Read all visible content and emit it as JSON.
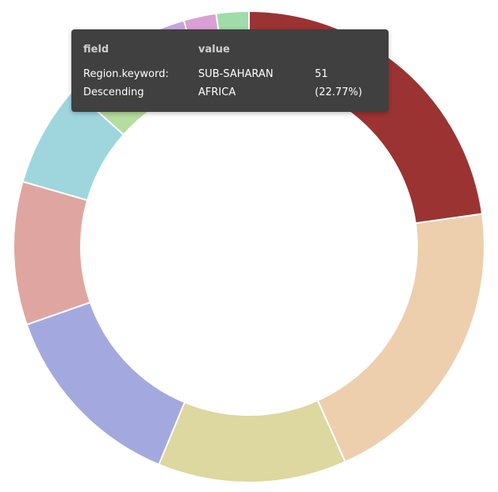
{
  "chart_data": {
    "type": "pie",
    "donut": true,
    "slices": [
      {
        "value": 51,
        "color": "#9b3333"
      },
      {
        "value": 46,
        "color": "#edcfae"
      },
      {
        "value": 29,
        "color": "#ddd7a0"
      },
      {
        "value": 30,
        "color": "#a3a9de"
      },
      {
        "value": 22,
        "color": "#dfa6a1"
      },
      {
        "value": 16,
        "color": "#9fd6de"
      },
      {
        "value": 13,
        "color": "#b4dd9e"
      },
      {
        "value": 7,
        "color": "#c7a6dd"
      },
      {
        "value": 5,
        "color": "#d9a0d5"
      },
      {
        "value": 5,
        "color": "#9fdcaa"
      }
    ]
  },
  "tooltip": {
    "header_field": "field",
    "header_value": "value",
    "field_line1": "Region.keyword:",
    "field_line2": "Descending",
    "value_line1": "SUB-SAHARAN",
    "value_line2": "AFRICA",
    "count": "51",
    "percent": "(22.77%)"
  }
}
